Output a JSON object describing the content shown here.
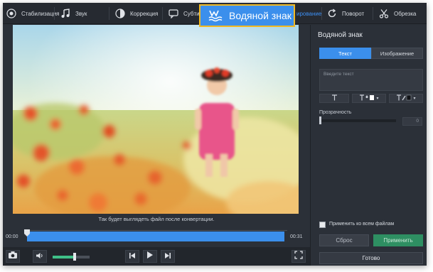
{
  "toolbar": {
    "items": [
      {
        "label": "Стабилизация",
        "icon": "stabilization-icon"
      },
      {
        "label": "Звук",
        "icon": "music-note-icon"
      },
      {
        "label": "Коррекция",
        "icon": "color-correction-icon"
      },
      {
        "label": "Субтит",
        "icon": "subtitles-icon"
      },
      {
        "label": "ирование",
        "icon": "crop-icon"
      },
      {
        "label": "Поворот",
        "icon": "rotate-icon"
      },
      {
        "label": "Обрезка",
        "icon": "scissors-icon"
      }
    ],
    "active_label": "Водяной знак",
    "active_icon": "watermark-icon",
    "accent_color": "#3b8fec",
    "highlight_border": "#f1b923"
  },
  "preview": {
    "caption": "Так будет выглядеть файл после конвертации."
  },
  "timeline": {
    "current_time": "00:00",
    "total_time": "00:31"
  },
  "controls": {
    "volume_level": 0.6
  },
  "panel": {
    "title": "Водяной знак",
    "tabs": [
      "Текст",
      "Изображение"
    ],
    "active_tab": "Текст",
    "text_placeholder": "Введите текст",
    "transparency_label": "Прозрачность",
    "transparency_value": "0",
    "apply_all_label": "Применить ко всем файлам",
    "reset_label": "Сброс",
    "apply_label": "Применить",
    "done_label": "Готово"
  }
}
